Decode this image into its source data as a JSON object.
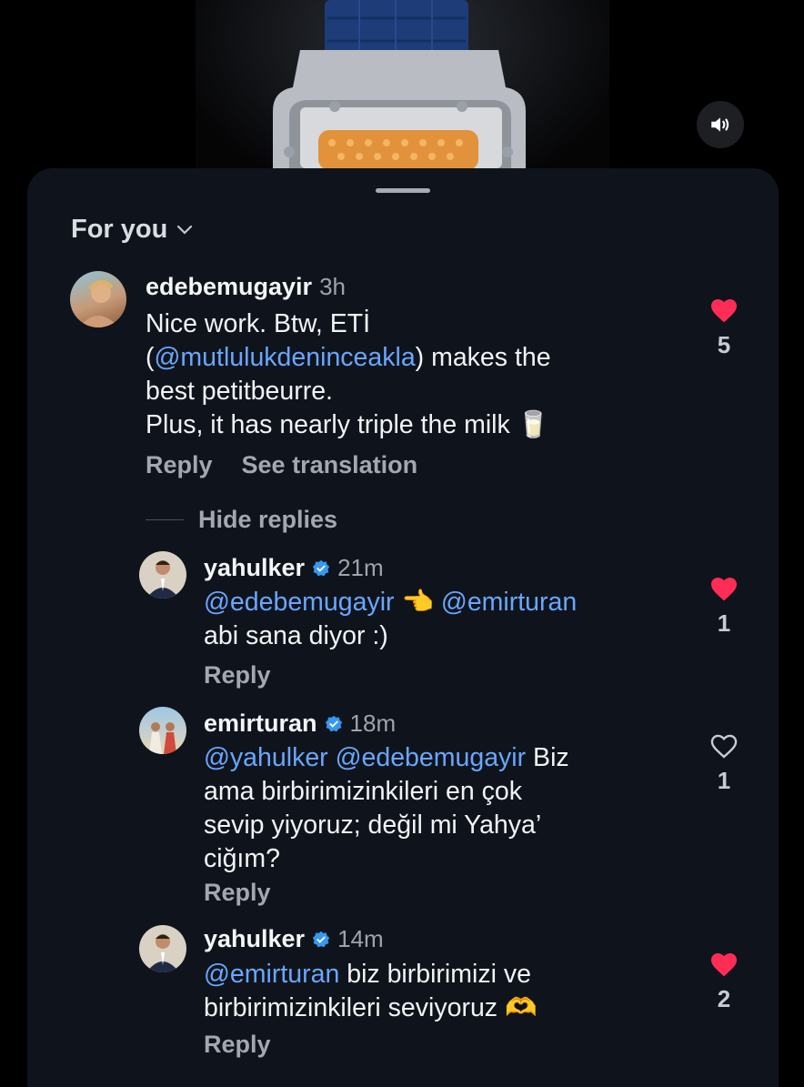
{
  "feed_filter": "For you",
  "comments": [
    {
      "username": "edebemugayir",
      "time": "3h",
      "lines": [
        [
          "Nice work. Btw, ETİ"
        ],
        [
          "(",
          "@mutlulukdeninceakla",
          ") makes the"
        ],
        [
          "best petitbeurre."
        ],
        [
          "Plus, it has nearly triple the milk 🥛"
        ]
      ],
      "actions": [
        "Reply",
        "See translation"
      ],
      "likes": "5",
      "liked": true
    },
    {
      "username": "yahulker",
      "verified": true,
      "time": "21m",
      "lines": [
        [
          "",
          "@edebemugayir",
          " 👈 ",
          "@emirturan"
        ],
        [
          "abi sana diyor :)"
        ]
      ],
      "actions": [
        "Reply"
      ],
      "likes": "1",
      "liked": true
    },
    {
      "username": "emirturan",
      "verified": true,
      "time": "18m",
      "lines": [
        [
          "",
          "@yahulker",
          " ",
          "@edebemugayir",
          " Biz"
        ],
        [
          "ama birbirimizinkileri en çok"
        ],
        [
          "sevip yiyoruz; değil mi Yahya’"
        ],
        [
          "ciğım?"
        ]
      ],
      "actions": [
        "Reply"
      ],
      "likes": "1",
      "liked": false
    },
    {
      "username": "yahulker",
      "verified": true,
      "time": "14m",
      "lines": [
        [
          "",
          "@emirturan",
          " biz birbirimizi ve"
        ],
        [
          "birbirimizinkileri seviyoruz 🫶"
        ]
      ],
      "actions": [
        "Reply"
      ],
      "likes": "2",
      "liked": true
    }
  ],
  "hide_replies_label": "Hide replies",
  "colors": {
    "sheet_bg": "#0f141c",
    "mention": "#6aa6ff",
    "like_red": "#ff2d55",
    "verified": "#3897f0"
  },
  "icons": [
    "speaker-icon",
    "chevron-down-icon",
    "heart-filled-icon",
    "heart-outline-icon",
    "verified-badge-icon"
  ]
}
